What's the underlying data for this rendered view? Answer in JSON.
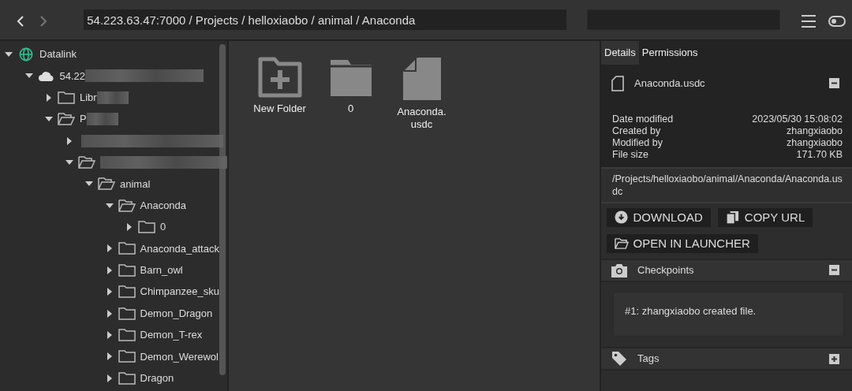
{
  "nav": {
    "back": {
      "disabled": false
    },
    "forward": {
      "disabled": true
    }
  },
  "address": {
    "value": "54.223.63.47:7000 / Projects / helloxiaobo / animal / Anaconda"
  },
  "tree": [
    {
      "label": "Datalink",
      "kind": "site",
      "expanded": true,
      "children": [
        {
          "label": "54.22",
          "kind": "server",
          "expanded": true,
          "blurred": true,
          "children": [
            {
              "label": "Libr",
              "kind": "folder",
              "expanded": false,
              "blurred": true
            },
            {
              "label": "P",
              "kind": "folder",
              "expanded": true,
              "blurred": true,
              "children": [
                {
                  "expanded": false,
                  "blurred": true
                },
                {
                  "kind": "folder",
                  "expanded": true,
                  "blurred": true,
                  "children": [
                    {
                      "label": "animal",
                      "kind": "folder",
                      "expanded": true,
                      "children": [
                        {
                          "label": "Anaconda",
                          "kind": "folder",
                          "expanded": true,
                          "children": [
                            {
                              "label": "0",
                              "kind": "folder",
                              "expanded": false
                            }
                          ]
                        },
                        {
                          "label": "Anaconda_attack",
                          "kind": "folder",
                          "expanded": false
                        },
                        {
                          "label": "Barn_owl",
                          "kind": "folder",
                          "expanded": false
                        },
                        {
                          "label": "Chimpanzee_sku",
                          "kind": "folder",
                          "expanded": false
                        },
                        {
                          "label": "Demon_Dragon",
                          "kind": "folder",
                          "expanded": false
                        },
                        {
                          "label": "Demon_T-rex",
                          "kind": "folder",
                          "expanded": false
                        },
                        {
                          "label": "Demon_Werewol",
                          "kind": "folder",
                          "expanded": false
                        },
                        {
                          "label": "Dragon",
                          "kind": "folder",
                          "expanded": false
                        }
                      ]
                    }
                  ]
                }
              ]
            }
          ]
        }
      ]
    }
  ],
  "items": [
    {
      "label": "New Folder",
      "kind": "new-folder"
    },
    {
      "label": "0",
      "kind": "folder"
    },
    {
      "label": "Anaconda.\nusdc",
      "kind": "file"
    }
  ],
  "tabs": [
    {
      "label": "Details",
      "selected": true
    },
    {
      "label": "Permissions",
      "selected": false
    }
  ],
  "file": {
    "name": "Anaconda.usdc",
    "expanded": true
  },
  "properties": [
    {
      "label": "Date modified",
      "value": "2023/05/30 15:08:02"
    },
    {
      "label": "Created by",
      "value": "zhangxiaobo"
    },
    {
      "label": "Modified by",
      "value": "zhangxiaobo"
    },
    {
      "label": "File size",
      "value": "171.70 KB"
    }
  ],
  "path": "/Projects/helloxiaobo/animal/Anaconda/Anaconda.usdc",
  "actions": [
    {
      "label": "DOWNLOAD",
      "kind": "download"
    },
    {
      "label": "COPY URL",
      "kind": "copy"
    },
    {
      "label": "OPEN IN LAUNCHER",
      "kind": "folder"
    }
  ],
  "checkpoints": {
    "title": "Checkpoints",
    "expanded": true,
    "entries": [
      "#1: zhangxiaobo created file."
    ]
  },
  "tags": {
    "title": "Tags",
    "expanded": false
  }
}
